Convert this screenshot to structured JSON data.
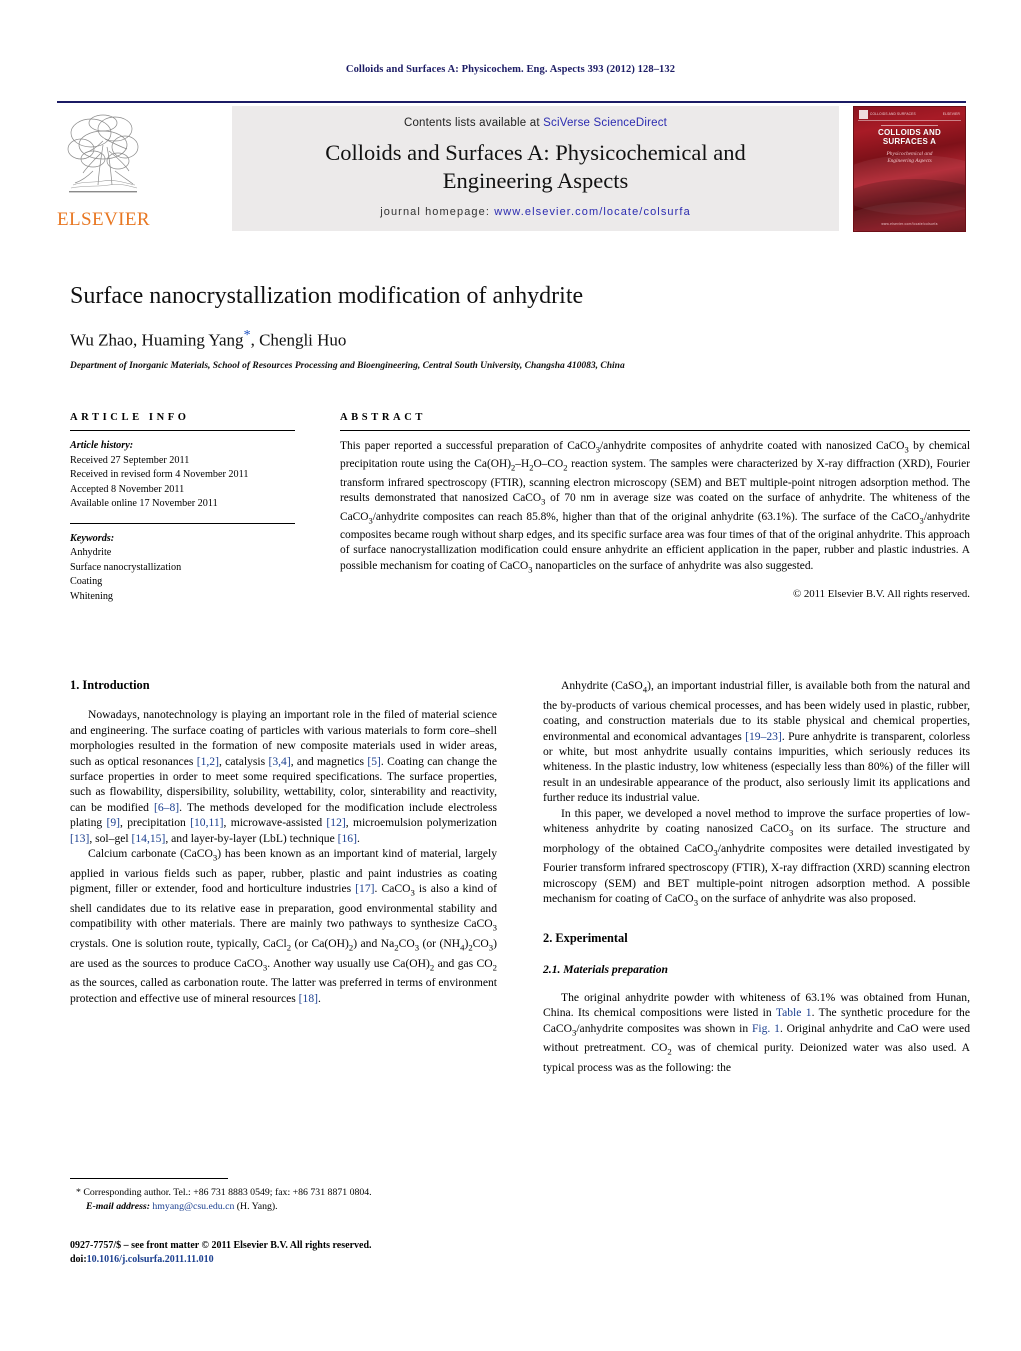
{
  "running_head": "Colloids and Surfaces A: Physicochem. Eng. Aspects 393 (2012) 128–132",
  "masthead": {
    "publisher_name": "ELSEVIER",
    "contents_prefix": "Contents lists available at ",
    "contents_link": "SciVerse ScienceDirect",
    "journal_title_line1": "Colloids and Surfaces A: Physicochemical and",
    "journal_title_line2": "Engineering Aspects",
    "homepage_prefix": "journal homepage: ",
    "homepage_url": "www.elsevier.com/locate/colsurfa",
    "cover": {
      "title_line1": "COLLOIDS AND",
      "title_line2": "SURFACES A",
      "subtitle_line1": "Physicochemical and",
      "subtitle_line2": "Engineering Aspects",
      "top_left": "COLLOIDS AND SURFACES",
      "top_right": "ELSEVIER",
      "bottom": "www.elsevier.com/locate/colsurfa",
      "accent_color": "#8c1420"
    }
  },
  "article": {
    "title": "Surface nanocrystallization modification of anhydrite",
    "authors": "Wu Zhao, Huaming Yang",
    "authors_tail": ", Chengli Huo",
    "corresponding_marker": "*",
    "affiliation": "Department of Inorganic Materials, School of Resources Processing and Bioengineering, Central South University, Changsha 410083, China"
  },
  "article_info": {
    "heading": "ARTICLE INFO",
    "history_label": "Article history:",
    "history": [
      "Received 27 September 2011",
      "Received in revised form 4 November 2011",
      "Accepted 8 November 2011",
      "Available online 17 November 2011"
    ],
    "keywords_label": "Keywords:",
    "keywords": [
      "Anhydrite",
      "Surface nanocrystallization",
      "Coating",
      "Whitening"
    ]
  },
  "abstract": {
    "heading": "ABSTRACT",
    "text_part1": "This paper reported a successful preparation of CaCO",
    "text_full": "This paper reported a successful preparation of CaCO3/anhydrite composites of anhydrite coated with nanosized CaCO3 by chemical precipitation route using the Ca(OH)2–H2O–CO2 reaction system. The samples were characterized by X-ray diffraction (XRD), Fourier transform infrared spectroscopy (FTIR), scanning electron microscopy (SEM) and BET multiple-point nitrogen adsorption method. The results demonstrated that nanosized CaCO3 of 70 nm in average size was coated on the surface of anhydrite. The whiteness of the CaCO3/anhydrite composites can reach 85.8%, higher than that of the original anhydrite (63.1%). The surface of the CaCO3/anhydrite composites became rough without sharp edges, and its specific surface area was four times of that of the original anhydrite. This approach of surface nanocrystallization modification could ensure anhydrite an efficient application in the paper, rubber and plastic industries. A possible mechanism for coating of CaCO3 nanoparticles on the surface of anhydrite was also suggested.",
    "copyright": "© 2011 Elsevier B.V. All rights reserved."
  },
  "sections": {
    "introduction_heading": "1. Introduction",
    "intro_p1": "Nowadays, nanotechnology is playing an important role in the filed of material science and engineering. The surface coating of particles with various materials to form core–shell morphologies resulted in the formation of new composite materials used in wider areas, such as optical resonances [1,2], catalysis [3,4], and magnetics [5]. Coating can change the surface properties in order to meet some required specifications. The surface properties, such as flowability, dispersibility, solubility, wettability, color, sinterability and reactivity, can be modified [6–8]. The methods developed for the modification include electroless plating [9], precipitation [10,11], microwave-assisted [12], microemulsion polymerization [13], sol–gel [14,15], and layer-by-layer (LbL) technique [16].",
    "intro_p2": "Calcium carbonate (CaCO3) has been known as an important kind of material, largely applied in various fields such as paper, rubber, plastic and paint industries as coating pigment, filler or extender, food and horticulture industries [17]. CaCO3 is also a kind of shell candidates due to its relative ease in preparation, good environmental stability and compatibility with other materials. There are mainly two pathways to synthesize CaCO3 crystals. One is solution route, typically, CaCl2 (or Ca(OH)2) and Na2CO3 (or (NH4)2CO3) are used as the sources to produce CaCO3. Another way usually use Ca(OH)2 and gas CO2 as the sources, called as carbonation route. The latter was preferred in terms of environment protection and effective use of mineral resources [18].",
    "right_p1": "Anhydrite (CaSO4), an important industrial filler, is available both from the natural and the by-products of various chemical processes, and has been widely used in plastic, rubber, coating, and construction materials due to its stable physical and chemical properties, environmental and economical advantages [19–23]. Pure anhydrite is transparent, colorless or white, but most anhydrite usually contains impurities, which seriously reduces its whiteness. In the plastic industry, low whiteness (especially less than 80%) of the filler will result in an undesirable appearance of the product, also seriously limit its applications and further reduce its industrial value.",
    "right_p2": "In this paper, we developed a novel method to improve the surface properties of low-whiteness anhydrite by coating nanosized CaCO3 on its surface. The structure and morphology of the obtained CaCO3/anhydrite composites were detailed investigated by Fourier transform infrared spectroscopy (FTIR), X-ray diffraction (XRD) scanning electron microscopy (SEM) and BET multiple-point nitrogen adsorption method. A possible mechanism for coating of CaCO3 on the surface of anhydrite was also proposed.",
    "experimental_heading": "2. Experimental",
    "materials_heading": "2.1. Materials preparation",
    "materials_p1": "The original anhydrite powder with whiteness of 63.1% was obtained from Hunan, China. Its chemical compositions were listed in Table 1. The synthetic procedure for the CaCO3/anhydrite composites was shown in Fig. 1. Original anhydrite and CaO were used without pretreatment. CO2 was of chemical purity. Deionized water was also used. A typical process was as the following: the"
  },
  "footnotes": {
    "corresponding": "* Corresponding author. Tel.: +86 731 8883 0549; fax: +86 731 8871 0804.",
    "email_label": "E-mail address:",
    "email": "hmyang@csu.edu.cn",
    "email_owner": "(H. Yang).",
    "issn_line": "0927-7757/$ – see front matter © 2011 Elsevier B.V. All rights reserved.",
    "doi_label": "doi:",
    "doi": "10.1016/j.colsurfa.2011.11.010"
  }
}
